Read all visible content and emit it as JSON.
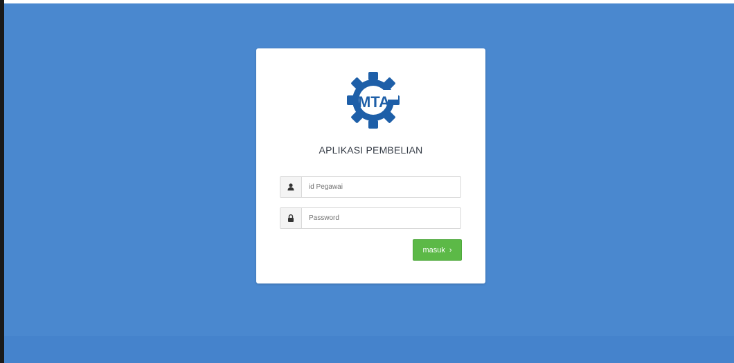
{
  "app": {
    "title": "APLIKASI PEMBELIAN",
    "logo_text": "MTA"
  },
  "form": {
    "username": {
      "placeholder": "id Pegawai",
      "value": "",
      "icon": "user-icon"
    },
    "password": {
      "placeholder": "Password",
      "value": "",
      "icon": "lock-icon"
    },
    "submit_label": "masuk",
    "submit_icon": "chevron-right-icon"
  },
  "colors": {
    "background": "#4a88cf",
    "card": "#ffffff",
    "logo": "#1e5fa8",
    "submit": "#5cb947"
  }
}
